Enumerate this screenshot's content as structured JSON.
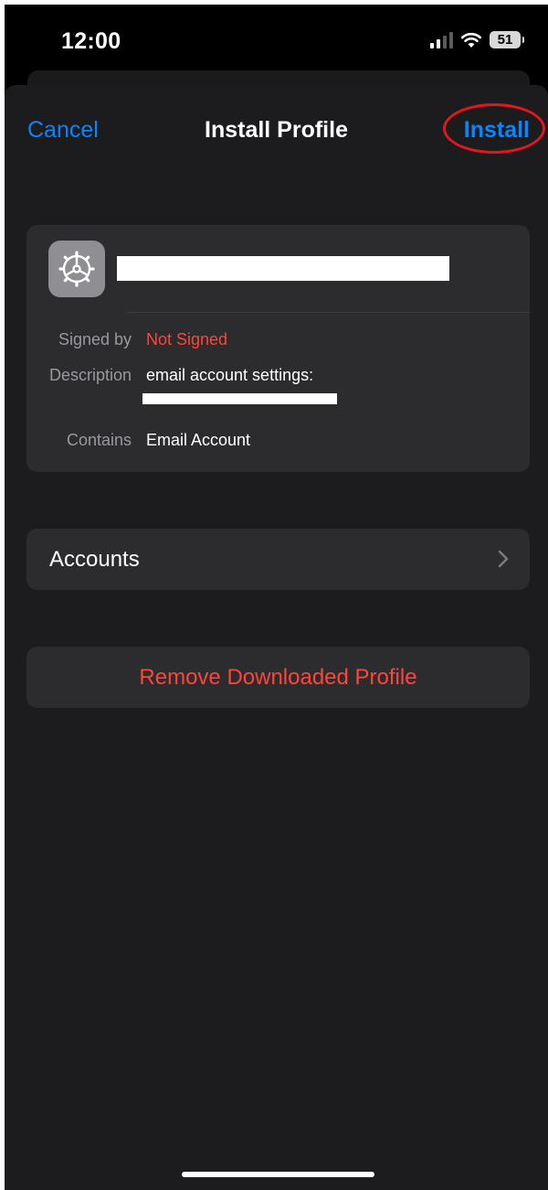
{
  "status_bar": {
    "time": "12:00",
    "battery_level": "51",
    "icons": [
      "signal-icon",
      "wifi-icon",
      "battery-icon"
    ]
  },
  "nav": {
    "cancel_label": "Cancel",
    "title": "Install Profile",
    "install_label": "Install"
  },
  "profile": {
    "icon": "gear-icon",
    "details": {
      "signed_by_label": "Signed by",
      "signed_by_value": "Not Signed",
      "description_label": "Description",
      "description_value": "email account settings:",
      "contains_label": "Contains",
      "contains_value": "Email Account"
    }
  },
  "accounts": {
    "label": "Accounts",
    "icon": "chevron-right-icon"
  },
  "remove": {
    "label": "Remove Downloaded Profile"
  },
  "colors": {
    "accent": "#0a84ff",
    "destructive": "#ff453a",
    "annotation": "#e3161f",
    "background": "#1c1c1e",
    "card": "#2c2c2e"
  }
}
